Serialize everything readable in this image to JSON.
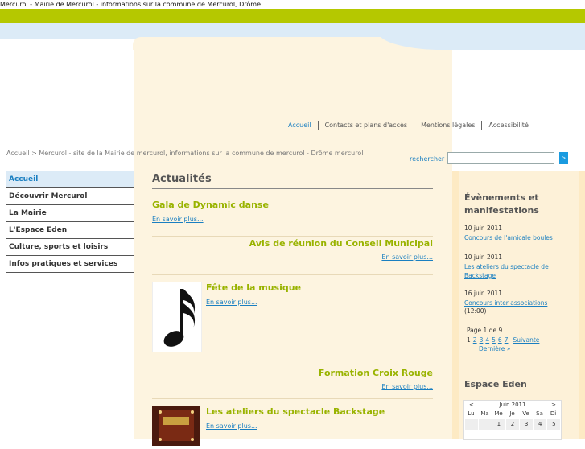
{
  "page": {
    "top_title": "Mercurol - Mairie de Mercurol - informations sur la commune de Mercurol, Drôme."
  },
  "colors": {
    "green": "#b5c800",
    "light_blue": "#dcebf7",
    "beige": "#fdf4e0",
    "link": "#1a7fc1",
    "news_title": "#99b300"
  },
  "topnav": {
    "items": [
      {
        "label": "Accueil"
      },
      {
        "label": "Contacts et plans d'accès"
      },
      {
        "label": "Mentions légales"
      },
      {
        "label": "Accessibilité"
      }
    ]
  },
  "breadcrumb": {
    "text": "Accueil > Mercurol - site de la Mairie de mercurol, informations sur la commune de mercurol - Drôme mercurol"
  },
  "search": {
    "label": "rechercher",
    "value": "",
    "button_label": ">"
  },
  "sidebar": {
    "items": [
      {
        "label": "Accueil"
      },
      {
        "label": "Découvrir Mercurol"
      },
      {
        "label": "La Mairie"
      },
      {
        "label": "L'Espace Eden"
      },
      {
        "label": "Culture, sports et loisirs"
      },
      {
        "label": "Infos pratiques et services"
      }
    ]
  },
  "main": {
    "title": "Actualités",
    "news": [
      {
        "title": "Gala de Dynamic danse",
        "more": "En savoir plus..."
      },
      {
        "title": "Avis de réunion du Conseil Municipal",
        "more": "En savoir plus..."
      },
      {
        "title": "Fête de la musique",
        "more": "En savoir plus..."
      },
      {
        "title": "Formation Croix Rouge",
        "more": "En savoir plus..."
      },
      {
        "title": "Les ateliers du spectacle Backstage",
        "more": "En savoir plus..."
      }
    ]
  },
  "events": {
    "heading": "Évènements et manifestations",
    "items": [
      {
        "date": "10 juin 2011",
        "title": "Concours de l'amicale boules",
        "time": ""
      },
      {
        "date": "10 juin 2011",
        "title": "Les ateliers du spectacle de Backstage",
        "time": ""
      },
      {
        "date": "16 juin 2011",
        "title": "Concours inter associations",
        "time": "(12:00)"
      }
    ],
    "pager": {
      "label": "Page 1 de 9",
      "current": "1",
      "pages": [
        "2",
        "3",
        "4",
        "5",
        "6",
        "7"
      ],
      "next": "Suivante",
      "last": "Dernière »"
    }
  },
  "espace_eden": {
    "heading": "Espace Eden",
    "calendar": {
      "prev": "<",
      "month": "Juin 2011",
      "next": ">",
      "weekdays": [
        "Lu",
        "Ma",
        "Me",
        "Je",
        "Ve",
        "Sa",
        "Di"
      ],
      "first_row": [
        "",
        "",
        "1",
        "2",
        "3",
        "4",
        "5"
      ]
    }
  }
}
